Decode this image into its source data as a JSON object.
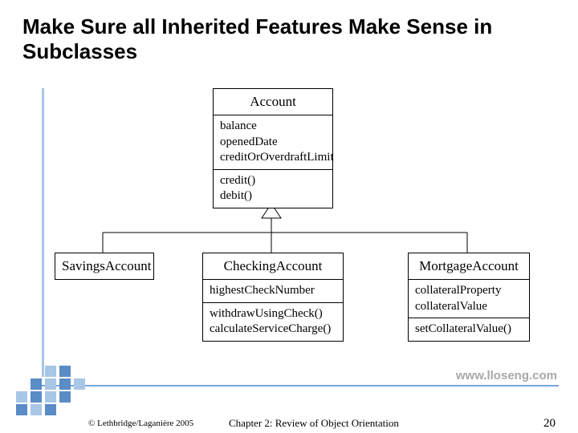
{
  "title": "Make Sure all Inherited Features Make Sense in Subclasses",
  "account": {
    "name": "Account",
    "attrs": [
      "balance",
      "openedDate",
      "creditOrOverdraftLimit"
    ],
    "methods": [
      "credit()",
      "debit()"
    ]
  },
  "savings": {
    "name": "SavingsAccount"
  },
  "checking": {
    "name": "CheckingAccount",
    "attrs": [
      "highestCheckNumber"
    ],
    "methods": [
      "withdrawUsingCheck()",
      "calculateServiceCharge()"
    ]
  },
  "mortgage": {
    "name": "MortgageAccount",
    "attrs": [
      "collateralProperty",
      "collateralValue"
    ],
    "methods": [
      "setCollateralValue()"
    ]
  },
  "website": "www.lloseng.com",
  "copyright": "© Lethbridge/Laganière 2005",
  "chapter": "Chapter 2: Review of Object Orientation",
  "page": "20",
  "chart_data": {
    "type": "uml-class-diagram",
    "superclass": "Account",
    "relationship": "generalization",
    "classes": [
      {
        "name": "Account",
        "attributes": [
          "balance",
          "openedDate",
          "creditOrOverdraftLimit"
        ],
        "operations": [
          "credit()",
          "debit()"
        ]
      },
      {
        "name": "SavingsAccount",
        "extends": "Account",
        "attributes": [],
        "operations": []
      },
      {
        "name": "CheckingAccount",
        "extends": "Account",
        "attributes": [
          "highestCheckNumber"
        ],
        "operations": [
          "withdrawUsingCheck()",
          "calculateServiceCharge()"
        ]
      },
      {
        "name": "MortgageAccount",
        "extends": "Account",
        "attributes": [
          "collateralProperty",
          "collateralValue"
        ],
        "operations": [
          "setCollateralValue()"
        ]
      }
    ]
  }
}
